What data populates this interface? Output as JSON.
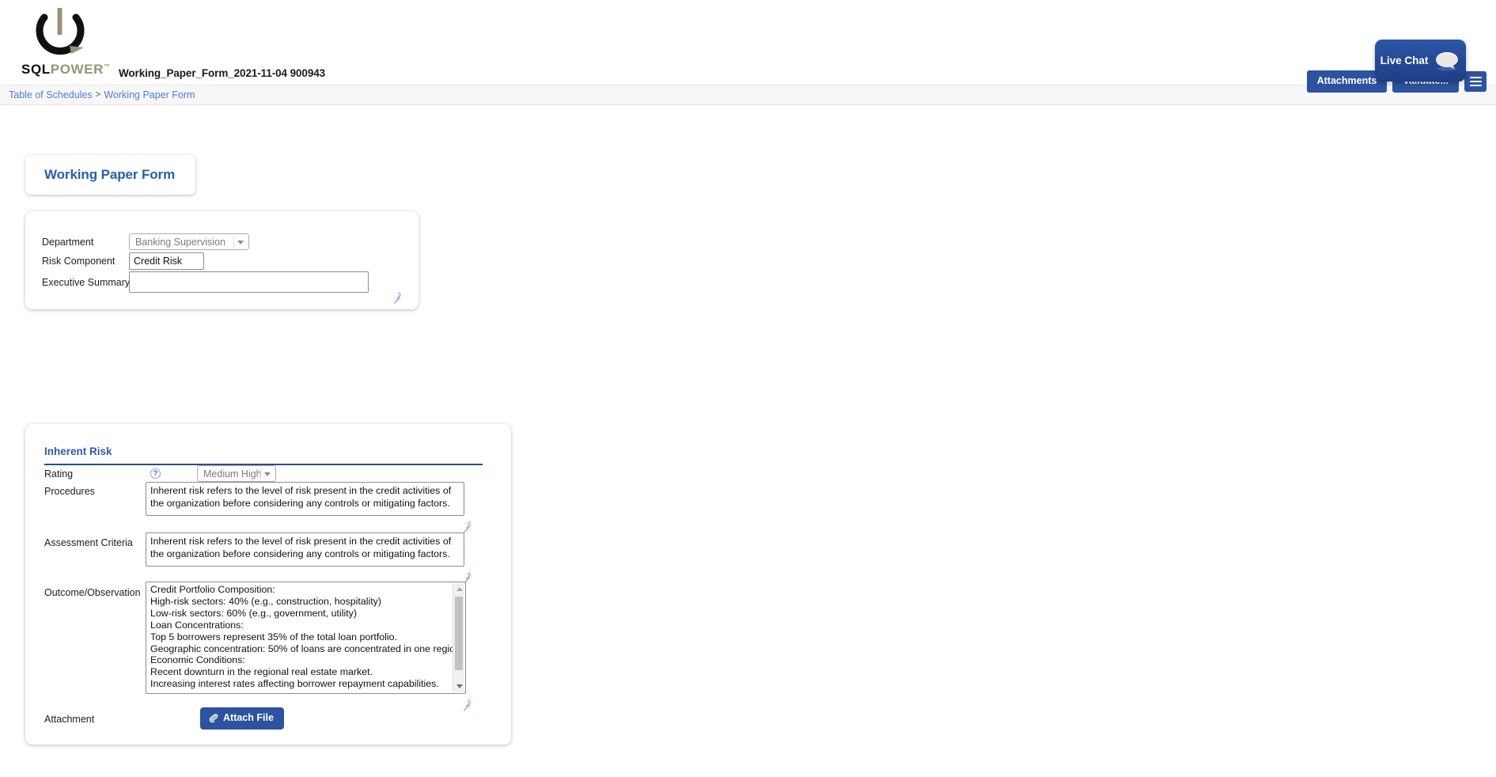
{
  "header": {
    "logo_sql": "SQL",
    "logo_power": "POWER",
    "logo_tm": "™",
    "document_title": "Working_Paper_Form_2021-11-04 900943",
    "buttons": {
      "attachments": "Attachments",
      "validate": "Validate...",
      "menu_icon": "hamburger-menu-icon"
    }
  },
  "breadcrumb": {
    "items": [
      {
        "label": "Table of Schedules"
      },
      {
        "label": "Working Paper Form"
      }
    ],
    "separator": ">"
  },
  "page_tab": {
    "title": "Working Paper Form"
  },
  "general": {
    "department": {
      "label": "Department",
      "value": "Banking Supervision"
    },
    "risk_component": {
      "label": "Risk Component",
      "value": "Credit Risk"
    },
    "executive_summary": {
      "label": "Executive Summary",
      "value": ""
    }
  },
  "inherent_risk": {
    "section_title": "Inherent Risk",
    "rating": {
      "label": "Rating",
      "help_icon": "?",
      "value": "Medium High"
    },
    "procedures": {
      "label": "Procedures",
      "value": "Inherent risk refers to the level of risk present in the credit activities of the organization before considering any controls or mitigating factors."
    },
    "assessment_criteria": {
      "label": "Assessment Criteria",
      "value": "Inherent risk refers to the level of risk present in the credit activities of the organization before considering any controls or mitigating factors."
    },
    "outcome_observation": {
      "label": "Outcome/Observation",
      "value": "Credit Portfolio Composition:\nHigh-risk sectors: 40% (e.g., construction, hospitality)\nLow-risk sectors: 60% (e.g., government, utility)\nLoan Concentrations:\nTop 5 borrowers represent 35% of the total loan portfolio.\nGeographic concentration: 50% of loans are concentrated in one region.\nEconomic Conditions:\nRecent downturn in the regional real estate market.\nIncreasing interest rates affecting borrower repayment capabilities."
    },
    "attachment": {
      "label": "Attachment",
      "button_label": "Attach File",
      "button_icon": "paperclip-icon"
    }
  },
  "live_chat": {
    "label": "Live Chat",
    "icon": "speech-bubble-icon"
  },
  "colors": {
    "brand_blue": "#2c52a0",
    "link_blue": "#4a7ddb",
    "heading_blue": "#2a5eaa",
    "logo_gold": "#9a9277"
  }
}
